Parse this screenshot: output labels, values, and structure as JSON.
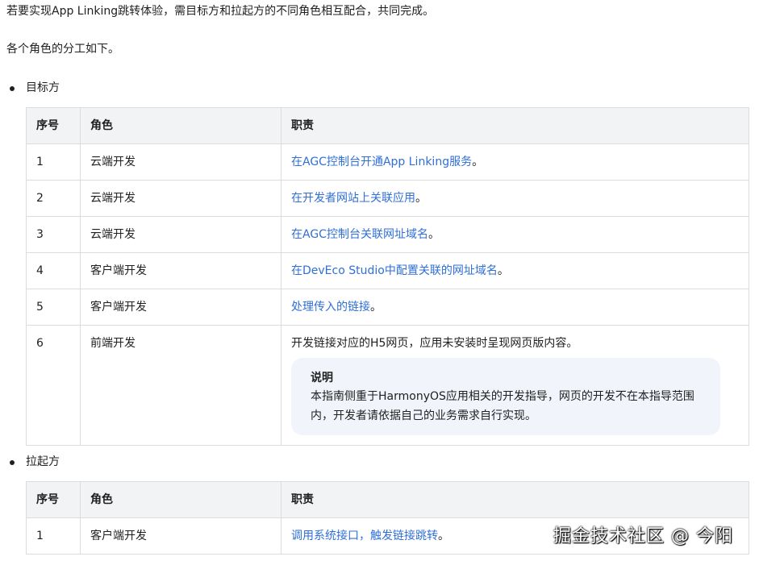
{
  "intro": {
    "line1": "若要实现App Linking跳转体验，需目标方和拉起方的不同角色相互配合，共同完成。",
    "line2": "各个角色的分工如下。"
  },
  "target_section": {
    "bullet": "目标方",
    "headers": {
      "seq": "序号",
      "role": "角色",
      "duty": "职责"
    },
    "rows": [
      {
        "seq": "1",
        "role": "云端开发",
        "duty": "在AGC控制台开通App Linking服务",
        "suffix": "。"
      },
      {
        "seq": "2",
        "role": "云端开发",
        "duty": "在开发者网站上关联应用",
        "suffix": "。"
      },
      {
        "seq": "3",
        "role": "云端开发",
        "duty": "在AGC控制台关联网址域名",
        "suffix": "。"
      },
      {
        "seq": "4",
        "role": "客户端开发",
        "duty": "在DevEco Studio中配置关联的网址域名",
        "suffix": "。"
      },
      {
        "seq": "5",
        "role": "客户端开发",
        "duty": "处理传入的链接",
        "suffix": "。"
      },
      {
        "seq": "6",
        "role": "前端开发",
        "duty": "开发链接对应的H5网页，应用未安装时呈现网页版内容。",
        "note_title": "说明",
        "note_body": "本指南侧重于HarmonyOS应用相关的开发指导，网页的开发不在本指导范围内，开发者请依据自己的业务需求自行实现。"
      }
    ]
  },
  "launcher_section": {
    "bullet": "拉起方",
    "headers": {
      "seq": "序号",
      "role": "角色",
      "duty": "职责"
    },
    "rows": [
      {
        "seq": "1",
        "role": "客户端开发",
        "duty": "调用系统接口，触发链接跳转",
        "suffix": "。"
      }
    ]
  },
  "watermark": "掘金技术社区 @ 今阳",
  "colors": {
    "link": "#2f6fd6",
    "header_bg": "#f1f3f5",
    "note_bg": "#f1f4fb",
    "border": "#dcdcdc"
  }
}
